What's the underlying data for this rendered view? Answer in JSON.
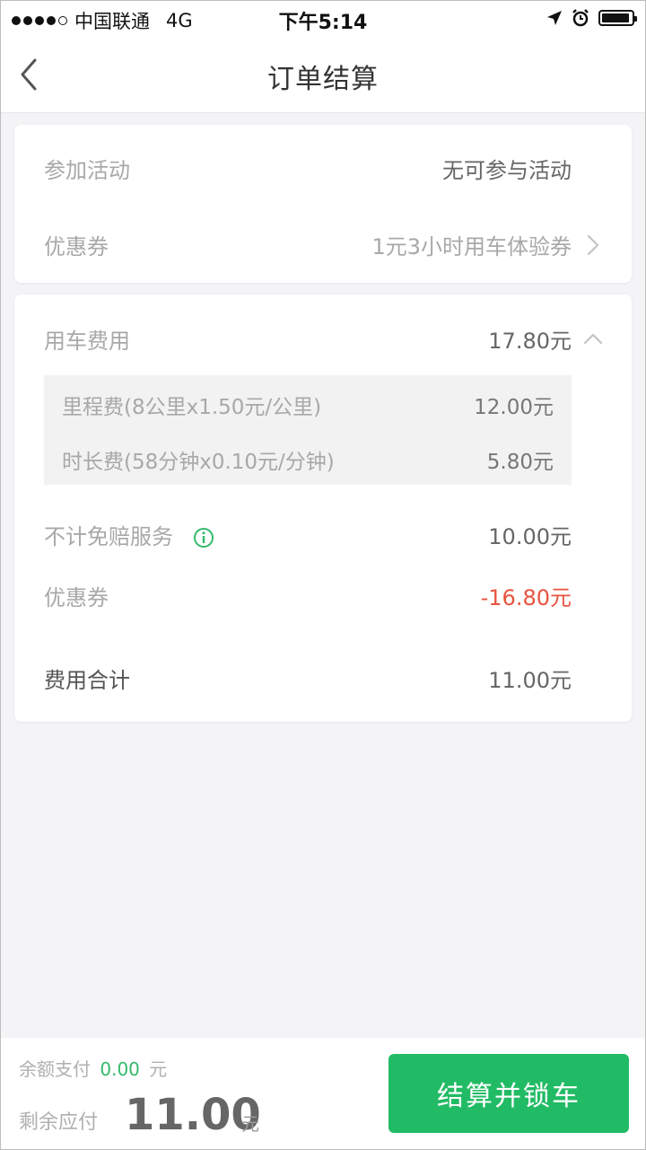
{
  "status_bar": {
    "carrier": "中国联通",
    "network": "4G",
    "time": "下午5:14"
  },
  "nav": {
    "title": "订单结算"
  },
  "promo_card": {
    "activity_label": "参加活动",
    "activity_value": "无可参与活动",
    "coupon_label": "优惠券",
    "coupon_value": "1元3小时用车体验券"
  },
  "fee_card": {
    "usage_label": "用车费用",
    "usage_value": "17.80元",
    "details": [
      {
        "label": "里程费(8公里x1.50元/公里)",
        "value": "12.00元"
      },
      {
        "label": "时长费(58分钟x0.10元/分钟)",
        "value": "5.80元"
      }
    ],
    "insurance_label": "不计免赔服务",
    "insurance_value": "10.00元",
    "coupon_label": "优惠券",
    "coupon_value": "-16.80元",
    "total_label": "费用合计",
    "total_value": "11.00元"
  },
  "bottom": {
    "balance_label": "余额支付",
    "balance_amount": "0.00",
    "balance_unit": "元",
    "remain_label": "剩余应付",
    "remain_amount": "11.00",
    "remain_unit": "元",
    "settle_button": "结算并锁车"
  },
  "colors": {
    "accent_green": "#22bb65",
    "discount_red": "#e8533f",
    "balance_green": "#33b96b"
  },
  "icons": [
    "back-arrow-icon",
    "chevron-right-icon",
    "chevron-up-icon",
    "info-icon",
    "location-arrow-icon",
    "alarm-icon",
    "battery-icon"
  ]
}
